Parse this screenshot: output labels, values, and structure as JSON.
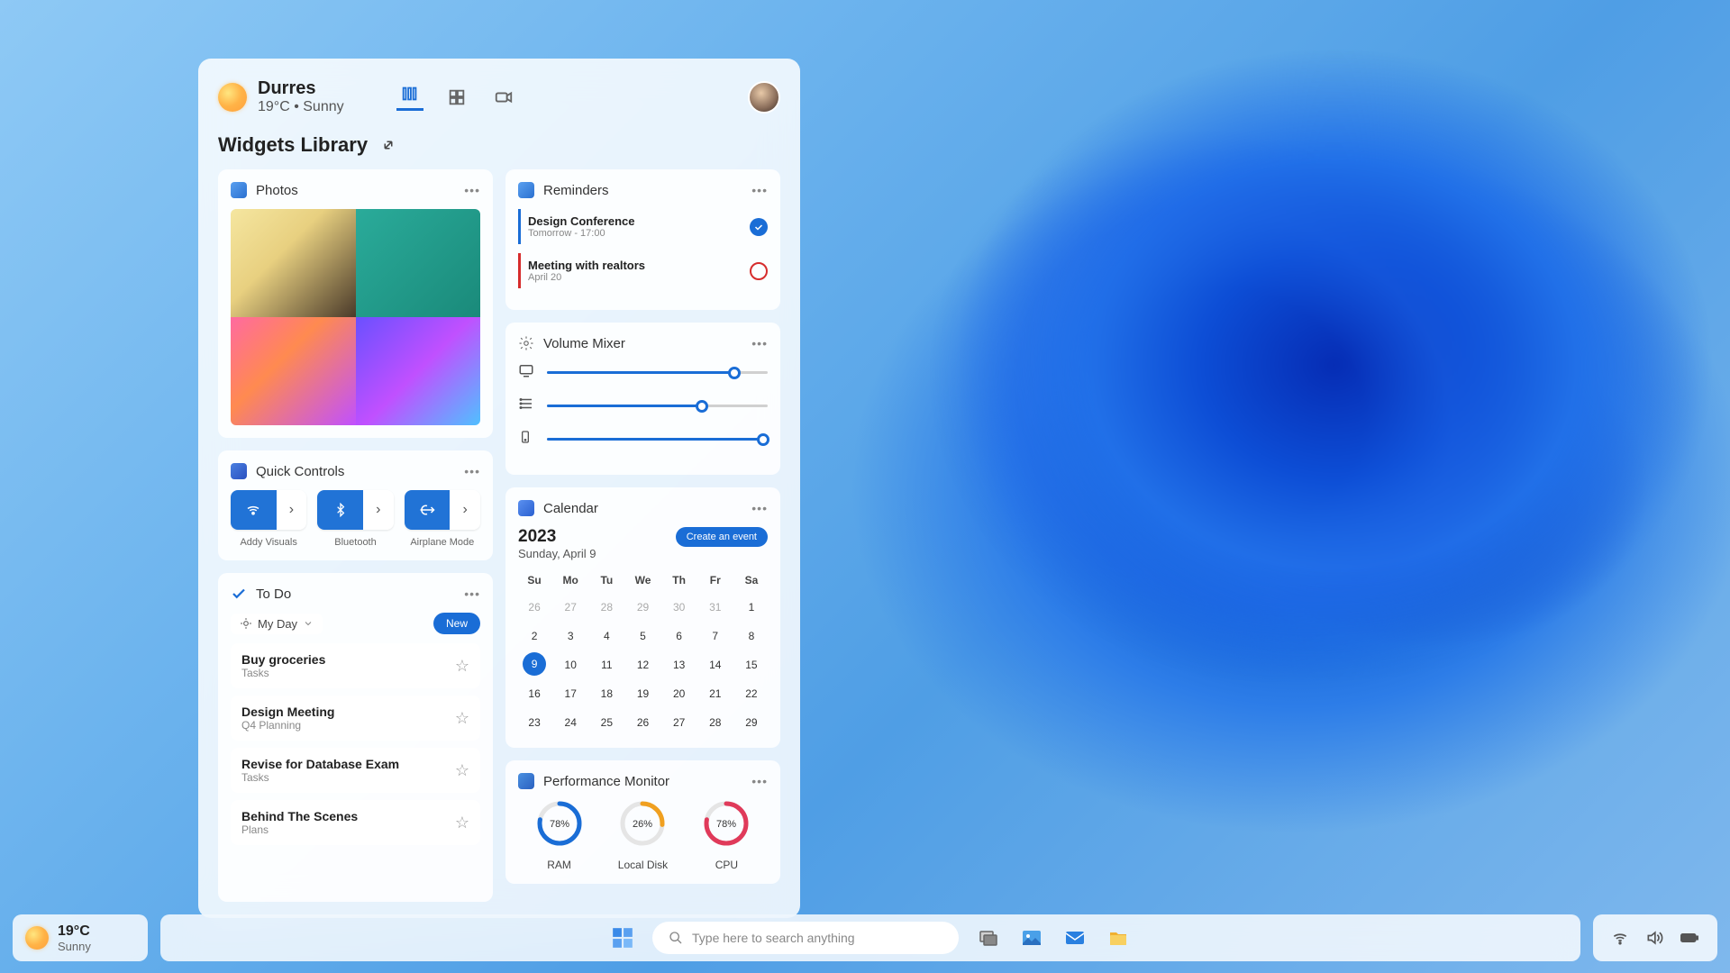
{
  "header": {
    "city": "Durres",
    "condition": "19°C  •  Sunny"
  },
  "library_title": "Widgets Library",
  "photos": {
    "title": "Photos"
  },
  "quick_controls": {
    "title": "Quick Controls",
    "items": [
      {
        "label": "Addy Visuals"
      },
      {
        "label": "Bluetooth"
      },
      {
        "label": "Airplane Mode"
      }
    ]
  },
  "todo": {
    "title": "To Do",
    "myday": "My Day",
    "new_button": "New",
    "items": [
      {
        "title": "Buy groceries",
        "subtitle": "Tasks"
      },
      {
        "title": "Design Meeting",
        "subtitle": "Q4 Planning"
      },
      {
        "title": "Revise for Database Exam",
        "subtitle": "Tasks"
      },
      {
        "title": "Behind The Scenes",
        "subtitle": "Plans"
      }
    ]
  },
  "reminders": {
    "title": "Reminders",
    "items": [
      {
        "title": "Design Conference",
        "subtitle": "Tomorrow - 17:00",
        "done": true,
        "color": "#1a6dd6"
      },
      {
        "title": "Meeting with realtors",
        "subtitle": "April 20",
        "done": false,
        "color": "#d62c2c"
      }
    ]
  },
  "volume": {
    "title": "Volume Mixer",
    "sliders": [
      85,
      70,
      98
    ]
  },
  "calendar": {
    "title": "Calendar",
    "year": "2023",
    "date": "Sunday, April 9",
    "create": "Create an event",
    "dow": [
      "Su",
      "Mo",
      "Tu",
      "We",
      "Th",
      "Fr",
      "Sa"
    ],
    "days": [
      [
        26,
        1
      ],
      [
        27,
        1
      ],
      [
        28,
        1
      ],
      [
        29,
        1
      ],
      [
        30,
        1
      ],
      [
        31,
        1
      ],
      [
        1,
        0
      ],
      [
        2,
        0
      ],
      [
        3,
        0
      ],
      [
        4,
        0
      ],
      [
        5,
        0
      ],
      [
        6,
        0
      ],
      [
        7,
        0
      ],
      [
        8,
        0
      ],
      [
        9,
        2
      ],
      [
        10,
        0
      ],
      [
        11,
        0
      ],
      [
        12,
        0
      ],
      [
        13,
        0
      ],
      [
        14,
        0
      ],
      [
        15,
        0
      ],
      [
        16,
        0
      ],
      [
        17,
        0
      ],
      [
        18,
        0
      ],
      [
        19,
        0
      ],
      [
        20,
        0
      ],
      [
        21,
        0
      ],
      [
        22,
        0
      ],
      [
        23,
        0
      ],
      [
        24,
        0
      ],
      [
        25,
        0
      ],
      [
        26,
        0
      ],
      [
        27,
        0
      ],
      [
        28,
        0
      ],
      [
        29,
        0
      ]
    ]
  },
  "performance": {
    "title": "Performance Monitor",
    "items": [
      {
        "label": "RAM",
        "value": "78%",
        "pct": 78,
        "color": "#1a6dd6"
      },
      {
        "label": "Local Disk",
        "value": "26%",
        "pct": 26,
        "color": "#f0a020"
      },
      {
        "label": "CPU",
        "value": "78%",
        "pct": 78,
        "color": "#e03a5a"
      }
    ]
  },
  "taskbar": {
    "temp": "19°C",
    "cond": "Sunny",
    "search_placeholder": "Type here to search anything"
  }
}
